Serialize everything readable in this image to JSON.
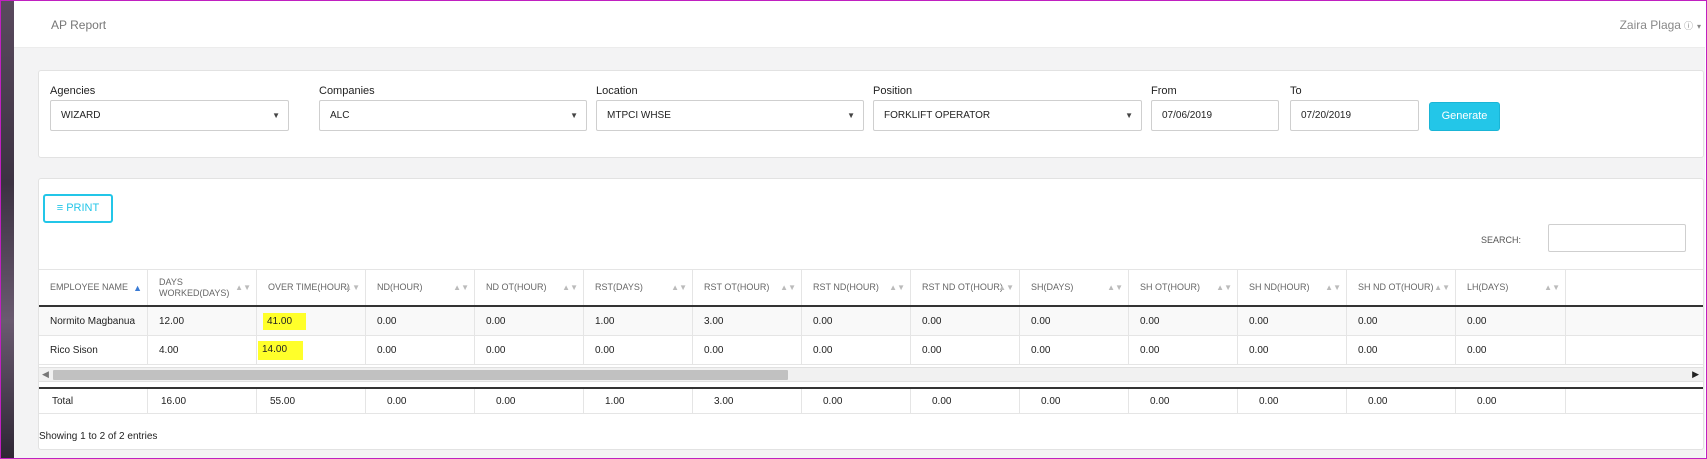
{
  "header": {
    "title": "AP Report",
    "user_name": "Zaira Plaga",
    "user_info_glyph": "ⓘ",
    "caret_glyph": "▾"
  },
  "filters": {
    "agencies": {
      "label": "Agencies",
      "value": "WIZARD"
    },
    "companies": {
      "label": "Companies",
      "value": "ALC"
    },
    "location": {
      "label": "Location",
      "value": "MTPCI WHSE"
    },
    "position": {
      "label": "Position",
      "value": "FORKLIFT OPERATOR"
    },
    "from": {
      "label": "From",
      "value": "07/06/2019"
    },
    "to": {
      "label": "To",
      "value": "07/20/2019"
    },
    "generate_label": "Generate",
    "dropdown_glyph": "▼"
  },
  "toolbar": {
    "print_label": "≡ PRINT",
    "search_label": "SEARCH:",
    "search_value": ""
  },
  "table": {
    "columns": [
      "EMPLOYEE NAME",
      "DAYS WORKED(DAYS)",
      "OVER TIME(HOUR)",
      "ND(HOUR)",
      "ND OT(HOUR)",
      "RST(DAYS)",
      "RST OT(HOUR)",
      "RST ND(HOUR)",
      "RST ND OT(HOUR)",
      "SH(DAYS)",
      "SH OT(HOUR)",
      "SH ND(HOUR)",
      "SH ND OT(HOUR)",
      "LH(DAYS)"
    ],
    "rows": [
      [
        "Normito Magbanua",
        "12.00",
        "41.00",
        "0.00",
        "0.00",
        "1.00",
        "3.00",
        "0.00",
        "0.00",
        "0.00",
        "0.00",
        "0.00",
        "0.00",
        "0.00"
      ],
      [
        "Rico Sison",
        "4.00",
        "14.00",
        "0.00",
        "0.00",
        "0.00",
        "0.00",
        "0.00",
        "0.00",
        "0.00",
        "0.00",
        "0.00",
        "0.00",
        "0.00"
      ]
    ],
    "totals": [
      "Total",
      "16.00",
      "55.00",
      "0.00",
      "0.00",
      "1.00",
      "3.00",
      "0.00",
      "0.00",
      "0.00",
      "0.00",
      "0.00",
      "0.00",
      "0.00"
    ],
    "sort_glyph": "▲▼",
    "sorted_glyph": "▲",
    "info": "Showing 1 to 2 of 2 entries",
    "scroll_left_glyph": "◀",
    "scroll_right_glyph": "▶"
  },
  "colors": {
    "accent": "#23c6e8",
    "highlight": "#ffff2a"
  }
}
